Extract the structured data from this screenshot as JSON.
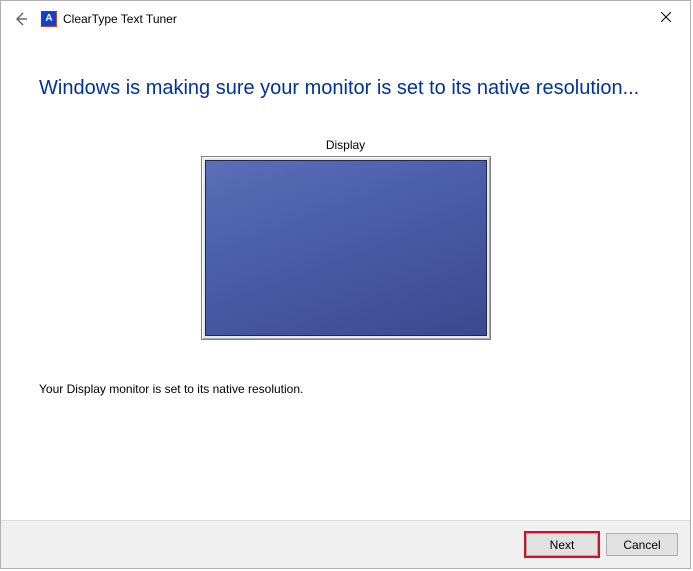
{
  "window": {
    "title": "ClearType Text Tuner",
    "icon_letter": "A"
  },
  "content": {
    "heading": "Windows is making sure your monitor is set to its native resolution...",
    "display_label": "Display",
    "status": "Your Display monitor is set to its native resolution."
  },
  "footer": {
    "next": "Next",
    "cancel": "Cancel"
  }
}
